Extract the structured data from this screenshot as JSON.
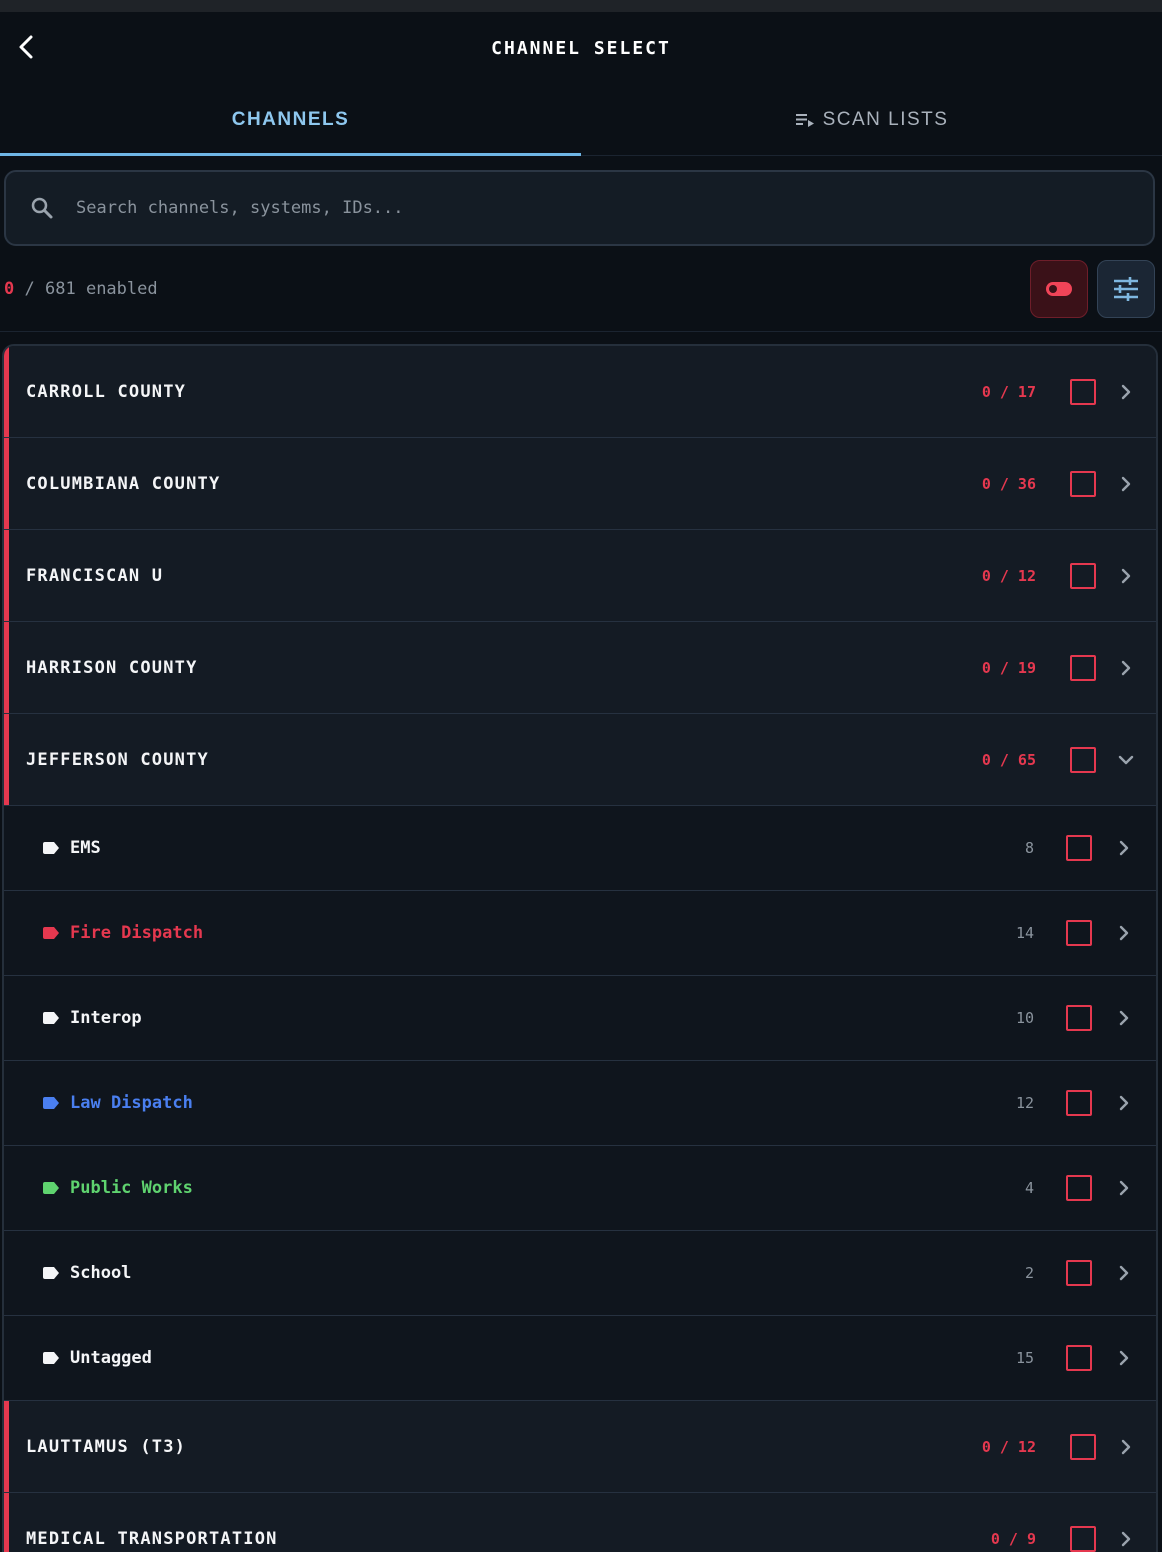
{
  "header": {
    "title": "CHANNEL SELECT"
  },
  "tabs": [
    {
      "label": "CHANNELS",
      "active": true
    },
    {
      "label": "SCAN LISTS",
      "active": false
    }
  ],
  "search": {
    "placeholder": "Search channels, systems, IDs..."
  },
  "summary": {
    "enabled": "0",
    "total": "681",
    "suffix": "enabled"
  },
  "systems_top": [
    {
      "name": "CARROLL COUNTY",
      "ratio": "0 / 17"
    },
    {
      "name": "COLUMBIANA COUNTY",
      "ratio": "0 / 36"
    },
    {
      "name": "FRANCISCAN U",
      "ratio": "0 / 12"
    },
    {
      "name": "HARRISON COUNTY",
      "ratio": "0 / 19"
    },
    {
      "name": "JEFFERSON COUNTY",
      "ratio": "0 / 65",
      "expanded": true
    }
  ],
  "jefferson_groups": [
    {
      "name": "EMS",
      "count": "8",
      "color": "#f4f5f7"
    },
    {
      "name": "Fire Dispatch",
      "count": "14",
      "color": "#e5384f"
    },
    {
      "name": "Interop",
      "count": "10",
      "color": "#f4f5f7"
    },
    {
      "name": "Law Dispatch",
      "count": "12",
      "color": "#4a7ff0"
    },
    {
      "name": "Public Works",
      "count": "4",
      "color": "#5fd36f"
    },
    {
      "name": "School",
      "count": "2",
      "color": "#f4f5f7"
    },
    {
      "name": "Untagged",
      "count": "15",
      "color": "#f4f5f7"
    }
  ],
  "systems_bottom": [
    {
      "name": "LAUTTAMUS (T3)",
      "ratio": "0 / 12"
    },
    {
      "name": "MEDICAL TRANSPORTATION",
      "ratio": "0 / 9"
    }
  ],
  "colors": {
    "accent": "#e5384f",
    "tab_active": "#8ec7ee"
  }
}
